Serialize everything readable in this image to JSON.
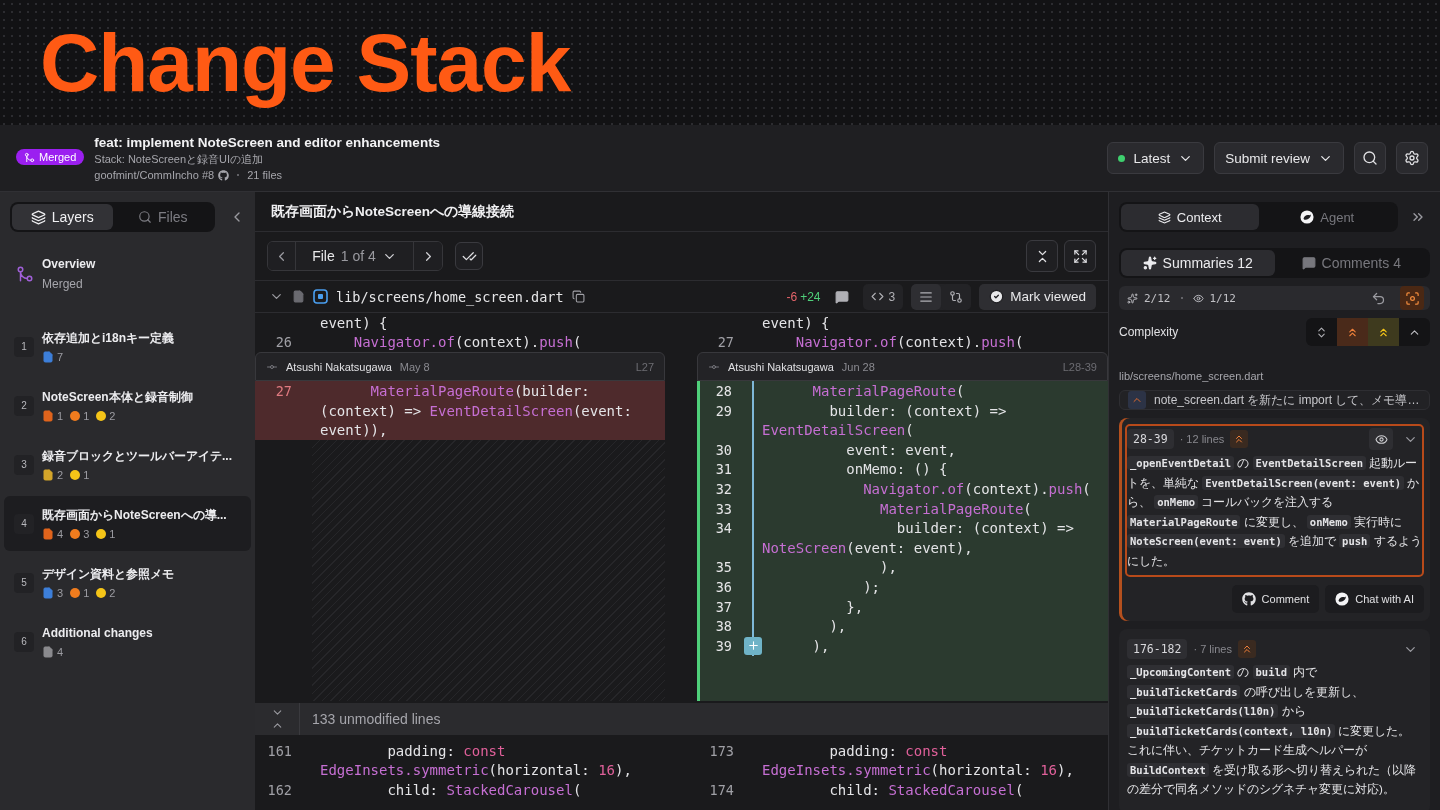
{
  "banner": {
    "title": "Change Stack"
  },
  "pr": {
    "status": "Merged",
    "title": "feat: implement NoteScreen and editor enhancements",
    "stack": "Stack: NoteScreenと録音UIの追加",
    "repo": "goofmint/CommIncho #8",
    "files": "21 files"
  },
  "toolbar": {
    "version": "Latest",
    "submit": "Submit review"
  },
  "sidebar": {
    "tabs": [
      {
        "label": "Layers",
        "selected": true
      },
      {
        "label": "Files",
        "selected": false
      }
    ],
    "overview": {
      "title": "Overview",
      "status": "Merged"
    },
    "layers": [
      {
        "index": "1",
        "title": "依存追加とi18nキー定義",
        "selected": false,
        "stats": [
          {
            "kind": "file",
            "color": "#3d7fd9",
            "count": "7"
          }
        ]
      },
      {
        "index": "2",
        "title": "NoteScreen本体と録音制御",
        "selected": false,
        "stats": [
          {
            "kind": "file",
            "color": "#e0641c",
            "count": "1"
          },
          {
            "kind": "dot",
            "color": "#f07c1e",
            "count": "1"
          },
          {
            "kind": "dot",
            "color": "#f5c518",
            "count": "2"
          }
        ]
      },
      {
        "index": "3",
        "title": "録音ブロックとツールバーアイテ...",
        "selected": false,
        "stats": [
          {
            "kind": "file",
            "color": "#d4a52a",
            "count": "2"
          },
          {
            "kind": "dot",
            "color": "#f5c518",
            "count": "1"
          }
        ]
      },
      {
        "index": "4",
        "title": "既存画面からNoteScreenへの導...",
        "selected": true,
        "stats": [
          {
            "kind": "file",
            "color": "#e0641c",
            "count": "4"
          },
          {
            "kind": "dot",
            "color": "#f07c1e",
            "count": "3"
          },
          {
            "kind": "dot",
            "color": "#f5c518",
            "count": "1"
          }
        ]
      },
      {
        "index": "5",
        "title": "デザイン資料と参照メモ",
        "selected": false,
        "stats": [
          {
            "kind": "file",
            "color": "#3d7fd9",
            "count": "3"
          },
          {
            "kind": "dot",
            "color": "#f07c1e",
            "count": "1"
          },
          {
            "kind": "dot",
            "color": "#f5c518",
            "count": "2"
          }
        ]
      },
      {
        "index": "6",
        "title": "Additional changes",
        "selected": false,
        "stats": [
          {
            "kind": "file",
            "color": "#8a8a8e",
            "count": "4"
          }
        ]
      }
    ]
  },
  "center": {
    "section_title": "既存画面からNoteScreenへの導線接続",
    "file_nav": {
      "word": "File",
      "position": "1 of 4"
    },
    "file": {
      "path": "lib/screens/home_screen.dart",
      "removed": "-6",
      "added": "+24",
      "hunks": "3",
      "mark": "Mark viewed"
    },
    "diff": {
      "left_context": [
        {
          "text": "event) {"
        },
        {
          "num": "26",
          "text": "    **Navigator.of**(context).**push**("
        }
      ],
      "right_context": [
        {
          "text": "event) {"
        },
        {
          "num": "27",
          "text": "    **Navigator.of**(context).**push**("
        }
      ],
      "left_hunk": {
        "kind": "removed",
        "author": "Atsushi Nakatsugawa",
        "date": "May 8",
        "range": "L27",
        "rows": [
          {
            "num": "27",
            "text": "      **MaterialPageRoute**(builder:"
          },
          {
            "text": "(context) => **EventDetailScreen**(event:"
          },
          {
            "text": "event)),"
          }
        ]
      },
      "right_hunk": {
        "kind": "added",
        "author": "Atsushi Nakatsugawa",
        "date": "Jun 28",
        "range": "L28-39",
        "rows": [
          {
            "num": "28",
            "text": "      **MaterialPageRoute**("
          },
          {
            "num": "29",
            "text": "        builder: (context) =>"
          },
          {
            "text": "**EventDetailScreen**("
          },
          {
            "num": "30",
            "text": "          event: event,"
          },
          {
            "num": "31",
            "text": "          onMemo: () {"
          },
          {
            "num": "32",
            "text": "            **Navigator.of**(context).**push**("
          },
          {
            "num": "33",
            "text": "              **MaterialPageRoute**("
          },
          {
            "num": "34",
            "text": "                builder: (context) =>"
          },
          {
            "text": "**NoteScreen**(event: event),"
          },
          {
            "num": "35",
            "text": "              ),"
          },
          {
            "num": "36",
            "text": "            );"
          },
          {
            "num": "37",
            "text": "          },"
          },
          {
            "num": "38",
            "text": "        ),"
          },
          {
            "num": "39",
            "add_comment": true,
            "text": "      ),"
          }
        ]
      },
      "collapsed": "133 unmodified lines",
      "left_after": [
        {
          "num": "161",
          "text": "        padding: *const*"
        },
        {
          "text": "**EdgeInsets.symmetric**(horizontal: *16*),"
        },
        {
          "num": "162",
          "text": "        child: **StackedCarousel**("
        }
      ],
      "right_after": [
        {
          "num": "173",
          "text": "        padding: *const*"
        },
        {
          "text": "**EdgeInsets.symmetric**(horizontal: *16*),"
        },
        {
          "num": "174",
          "text": "        child: **StackedCarousel**("
        }
      ]
    }
  },
  "panel": {
    "tabs": [
      {
        "label": "Context",
        "selected": true
      },
      {
        "label": "Agent",
        "selected": false
      }
    ],
    "subtabs": [
      {
        "label": "Summaries 12",
        "selected": true
      },
      {
        "label": "Comments 4",
        "selected": false
      }
    ],
    "progress": {
      "summarized": "2/12",
      "viewed": "1/12"
    },
    "complexity": {
      "label": "Complexity",
      "filters": [
        {
          "kind": "all",
          "selected": false
        },
        {
          "kind": "high",
          "selected": true
        },
        {
          "kind": "medium",
          "selected": true
        },
        {
          "kind": "low",
          "selected": false
        }
      ]
    },
    "file_path": "lib/screens/home_screen.dart",
    "file_summary": "note_screen.dart を新たに import して、メモ導…",
    "summaries": [
      {
        "range": "28-39",
        "lines": "· 12 lines",
        "kind": "high",
        "selected": true,
        "text": "**_openEventDetail** の **EventDetailScreen** 起動ルートを、単純な **EventDetailScreen(event: event)** から、 **onMemo** コールバックを注入する **MaterialPageRoute** に変更し、 **onMemo** 実行時に **NoteScreen(event: event)** を追加で **push** するようにした。",
        "actions": [
          "Comment",
          "Chat with AI"
        ]
      },
      {
        "range": "176-182",
        "lines": "· 7 lines",
        "kind": "high",
        "selected": false,
        "text": "**_UpcomingContent** の **build** 内で **_buildTicketCards** の呼び出しを更新し、 **_buildTicketCards(l10n)** から **_buildTicketCards(context, l10n)** に変更した。これに伴い、チケットカード生成ヘルパーが **BuildContext** を受け取る形へ切り替えられた（以降の差分で同名メソッドのシグネチャ変更に対応)。"
      }
    ]
  }
}
